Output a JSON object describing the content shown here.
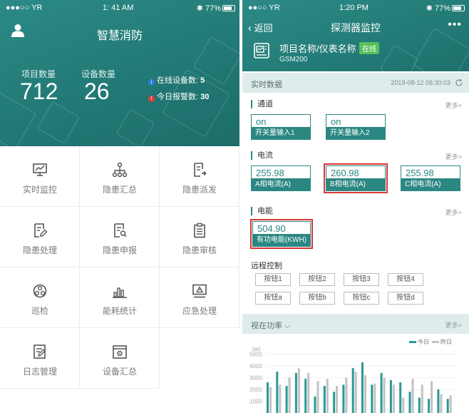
{
  "left": {
    "status": {
      "carrier": "●●●○○ YR",
      "time": "1: 41 AM",
      "battery": "77%",
      "battery_level": 0.77
    },
    "title": "智慧消防",
    "stats": {
      "project_label": "项目数量",
      "project_value": "712",
      "device_label": "设备数量",
      "device_value": "26",
      "online_label": "在线设备数:",
      "online_value": "5",
      "alarm_label": "今日报警数:",
      "alarm_value": "30"
    },
    "menu": [
      {
        "label": "实时监控",
        "icon": "monitor-chart-icon"
      },
      {
        "label": "隐患汇总",
        "icon": "hierarchy-icon"
      },
      {
        "label": "隐患派发",
        "icon": "document-send-icon"
      },
      {
        "label": "隐患处理",
        "icon": "document-edit-icon"
      },
      {
        "label": "隐患申报",
        "icon": "document-search-icon"
      },
      {
        "label": "隐患审核",
        "icon": "clipboard-icon"
      },
      {
        "label": "巡检",
        "icon": "patrol-icon"
      },
      {
        "label": "能耗统计",
        "icon": "bar-chart-icon"
      },
      {
        "label": "应急处理",
        "icon": "alert-screen-icon"
      },
      {
        "label": "日志管理",
        "icon": "log-edit-icon"
      },
      {
        "label": "设备汇总",
        "icon": "device-gear-icon"
      }
    ],
    "colors": {
      "primary": "#227975",
      "online_dot": "#2f7de1",
      "alarm_dot": "#e2413d"
    }
  },
  "right": {
    "status": {
      "carrier": "●●○○ YR",
      "time": "1:20 PM",
      "battery": "77%",
      "battery_level": 0.77
    },
    "back_label": "返回",
    "title": "探测器监控",
    "more_label": "•••",
    "device": {
      "name": "项目名称/仪表名称",
      "online": "在线",
      "model": "GSM200"
    },
    "realtime": {
      "title": "实时数据",
      "timestamp": "2019-08-12 08:30:03"
    },
    "channel": {
      "title": "通道",
      "more": "更多>",
      "items": [
        {
          "value": "on",
          "name": "开关量输入1"
        },
        {
          "value": "on",
          "name": "开关量输入2"
        }
      ]
    },
    "current": {
      "title": "电流",
      "more": "更多>",
      "items": [
        {
          "value": "255.98",
          "name": "A相电流(A)"
        },
        {
          "value": "260.98",
          "name": "B相电流(A)",
          "highlight": true
        },
        {
          "value": "255.98",
          "name": "C相电流(A)"
        }
      ]
    },
    "energy": {
      "title": "电能",
      "more": "更多>",
      "items": [
        {
          "value": "504.90",
          "name": "有功电能(KWH)",
          "highlight": true
        }
      ]
    },
    "remote": {
      "title": "远程控制",
      "buttons": [
        "按钮1",
        "按钮2",
        "按钮3",
        "按钮4",
        "按钮a",
        "按钮b",
        "按钮c",
        "按钮d"
      ]
    },
    "chart_header": {
      "title": "视在功率",
      "more": "更多>"
    },
    "colors": {
      "primary": "#2a8782",
      "highlight": "#d9373a",
      "today": "#2a9a95",
      "yesterday": "#c2c2c2"
    }
  },
  "chart_data": {
    "type": "bar",
    "title": "",
    "ylabel": "(w)",
    "yticks": [
      "5000",
      "4000",
      "3000",
      "2000",
      "1000"
    ],
    "ylim": [
      0,
      5200
    ],
    "legend": "top-right",
    "series": [
      {
        "name": "今日",
        "color": "#2a9a95",
        "values": [
          2600,
          3500,
          2300,
          3400,
          2900,
          1400,
          2300,
          1800,
          2400,
          3800,
          4300,
          2400,
          3400,
          2800,
          2600,
          1800,
          1300,
          1200,
          2000,
          1200
        ]
      },
      {
        "name": "昨日",
        "color": "#c2c2c2",
        "values": [
          2200,
          2400,
          3000,
          3800,
          3400,
          2700,
          2900,
          2300,
          3000,
          3500,
          3200,
          2500,
          3000,
          2400,
          1300,
          2900,
          2400,
          2700,
          1600,
          1500
        ]
      }
    ]
  }
}
